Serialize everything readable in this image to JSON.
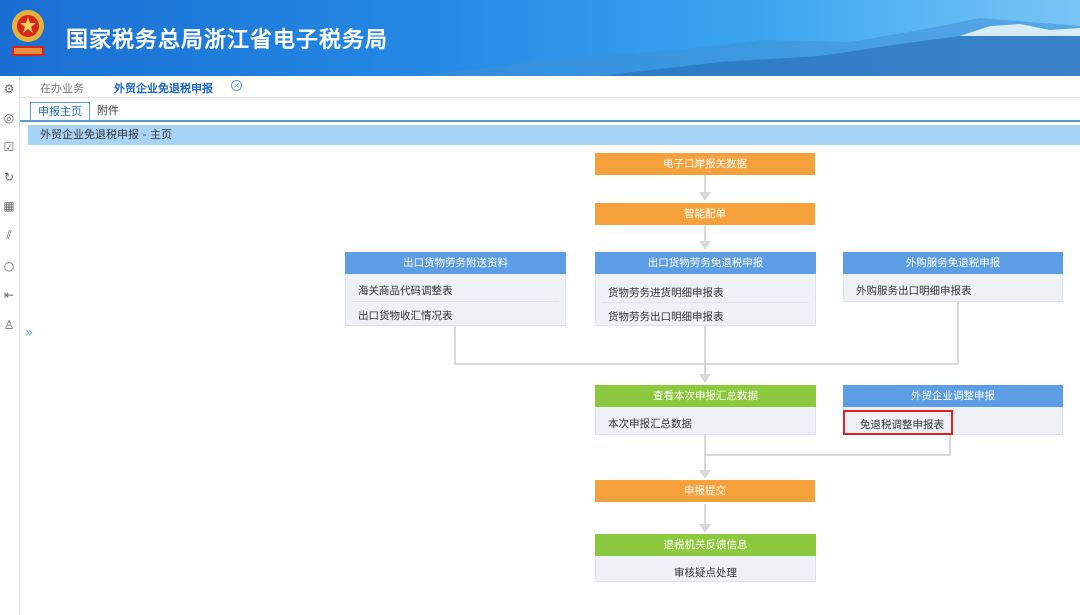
{
  "header": {
    "title": "国家税务总局浙江省电子税务局"
  },
  "tabs": {
    "inactive_label": "在办业务",
    "active_label": "外贸企业免退税申报",
    "close_symbol": "×"
  },
  "subtabs": {
    "main_label": "申报主页",
    "attachment_label": "附件"
  },
  "breadcrumb": "外贸企业免退税申报 - 主页",
  "flow": {
    "customs_data": "电子口岸报关数据",
    "smart_match": "智能配单",
    "attach_docs": {
      "title": "出口货物劳务附送资料",
      "items": [
        "海关商品代码调整表",
        "出口货物收汇情况表"
      ]
    },
    "export_declare": {
      "title": "出口货物劳务免退税申报",
      "items": [
        "货物劳务进货明细申报表",
        "货物劳务出口明细申报表"
      ]
    },
    "service_declare": {
      "title": "外购服务免退税申报",
      "items": [
        "外购服务出口明细申报表"
      ]
    },
    "summary": {
      "title": "查看本次申报汇总数据",
      "items": [
        "本次申报汇总数据"
      ]
    },
    "adjust": {
      "title": "外贸企业调整申报",
      "items": [
        "免退税调整申报表"
      ]
    },
    "submit": "申报提交",
    "feedback": {
      "title": "退税机关反馈信息",
      "items": [
        "审核疑点处理"
      ]
    }
  },
  "colors": {
    "orange": "#f7a13d",
    "green": "#8dc93f",
    "blue": "#5d9de4",
    "highlight": "#e02020"
  }
}
